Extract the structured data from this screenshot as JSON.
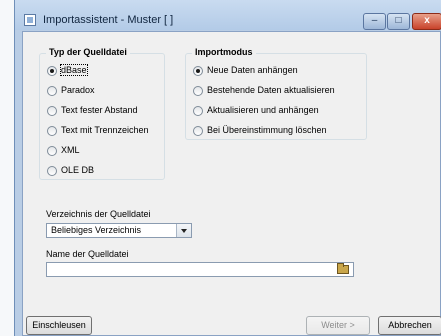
{
  "window": {
    "title": "Importassistent - Muster [ ]",
    "controls": {
      "minimize": "–",
      "maximize": "□",
      "close": "x"
    }
  },
  "source_type": {
    "title": "Typ der Quelldatei",
    "options": [
      "dBase",
      "Paradox",
      "Text fester Abstand",
      "Text mit Trennzeichen",
      "XML",
      "OLE DB"
    ],
    "selected": "dBase"
  },
  "import_mode": {
    "title": "Importmodus",
    "options": [
      "Neue Daten anhängen",
      "Bestehende Daten aktualisieren",
      "Aktualisieren und anhängen",
      "Bei Übereinstimmung löschen"
    ],
    "selected": "Neue Daten anhängen"
  },
  "directory": {
    "label": "Verzeichnis der Quelldatei",
    "value": "Beliebiges Verzeichnis"
  },
  "filename": {
    "label": "Name der Quelldatei",
    "value": ""
  },
  "buttons": {
    "import_label": "Einschleusen",
    "next_label": "Weiter >",
    "cancel_label": "Abbrechen"
  }
}
